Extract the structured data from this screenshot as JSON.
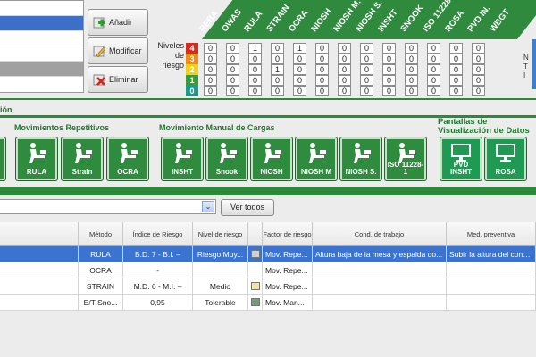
{
  "side_buttons": {
    "add": "Añadir",
    "modify": "Modificar",
    "delete": "Eliminar"
  },
  "methods": [
    "REBA",
    "OWAS",
    "RULA",
    "STRAIN",
    "OCRA",
    "NIOSH",
    "NIOSH M.",
    "NIOSH S.",
    "INSHT",
    "SNOOK",
    "ISO 11228",
    "ROSA",
    "PVD IN.",
    "WBGT"
  ],
  "levels_label": "Niveles de riesgo",
  "levels": [
    {
      "value": "4",
      "color": "#d62b1e",
      "cells": [
        "0",
        "0",
        "1",
        "0",
        "1",
        "0",
        "0",
        "0",
        "0",
        "0",
        "0",
        "0",
        "0"
      ]
    },
    {
      "value": "3",
      "color": "#f08a1c",
      "cells": [
        "0",
        "0",
        "0",
        "0",
        "0",
        "0",
        "0",
        "0",
        "0",
        "0",
        "0",
        "0",
        "0"
      ]
    },
    {
      "value": "2",
      "color": "#f2cf1a",
      "cells": [
        "0",
        "0",
        "0",
        "1",
        "0",
        "0",
        "0",
        "0",
        "0",
        "0",
        "0",
        "0",
        "0"
      ]
    },
    {
      "value": "1",
      "color": "#3a9a3e",
      "cells": [
        "0",
        "0",
        "0",
        "0",
        "0",
        "0",
        "0",
        "0",
        "0",
        "0",
        "0",
        "0",
        "0"
      ]
    },
    {
      "value": "0",
      "color": "#1f9a8a",
      "cells": [
        "0",
        "0",
        "0",
        "0",
        "0",
        "0",
        "0",
        "0",
        "0",
        "0",
        "0",
        "0",
        "0"
      ]
    }
  ],
  "sections": {
    "partial_top": "ión",
    "repetitive": "Movimientos Repetitivos",
    "manual": "Movimiento Manual de Cargas",
    "screens": "Pantallas de Visualización de Datos"
  },
  "repetitive_buttons": [
    "RULA",
    "Strain",
    "OCRA"
  ],
  "manual_buttons": [
    "INSHT",
    "Snook",
    "NIOSH",
    "NIOSH M",
    "NIOSH S.",
    "ISO 11228-1"
  ],
  "screen_buttons": [
    "PVD INSHT",
    "ROSA"
  ],
  "filter": {
    "value": "",
    "arrow": "⌄"
  },
  "ver_todos": "Ver todos",
  "table": {
    "headers": [
      "Método",
      "Índice de Riesgo",
      "Nivel de riesgo",
      "",
      "Factor de riesgo",
      "Cond. de trabajo",
      "Med. preventiva"
    ],
    "rows": [
      {
        "method": "RULA",
        "index": "B.D. 7 - B.I. –",
        "level": "Riesgo Muy...",
        "flag": "#d0d0d0",
        "factor": "Mov. Repe...",
        "cond": "Altura baja de la mesa y espalda do...",
        "med": "Subir la altura del contene",
        "selected": true
      },
      {
        "method": "OCRA",
        "index": "-",
        "level": "",
        "flag": "",
        "factor": "Mov. Repe...",
        "cond": "",
        "med": "",
        "selected": false
      },
      {
        "method": "STRAIN",
        "index": "M.D. 6 - M.I. –",
        "level": "Medio",
        "flag": "#f6e49a",
        "factor": "Mov. Repe...",
        "cond": "",
        "med": "",
        "selected": false
      },
      {
        "method": "E/T Sno...",
        "index": "0,95",
        "level": "Tolerable",
        "flag": "#7a9a7a",
        "factor": "Mov. Man...",
        "cond": "",
        "med": "",
        "selected": false
      }
    ]
  },
  "right_edge_letters": [
    "N",
    "T",
    "I"
  ]
}
